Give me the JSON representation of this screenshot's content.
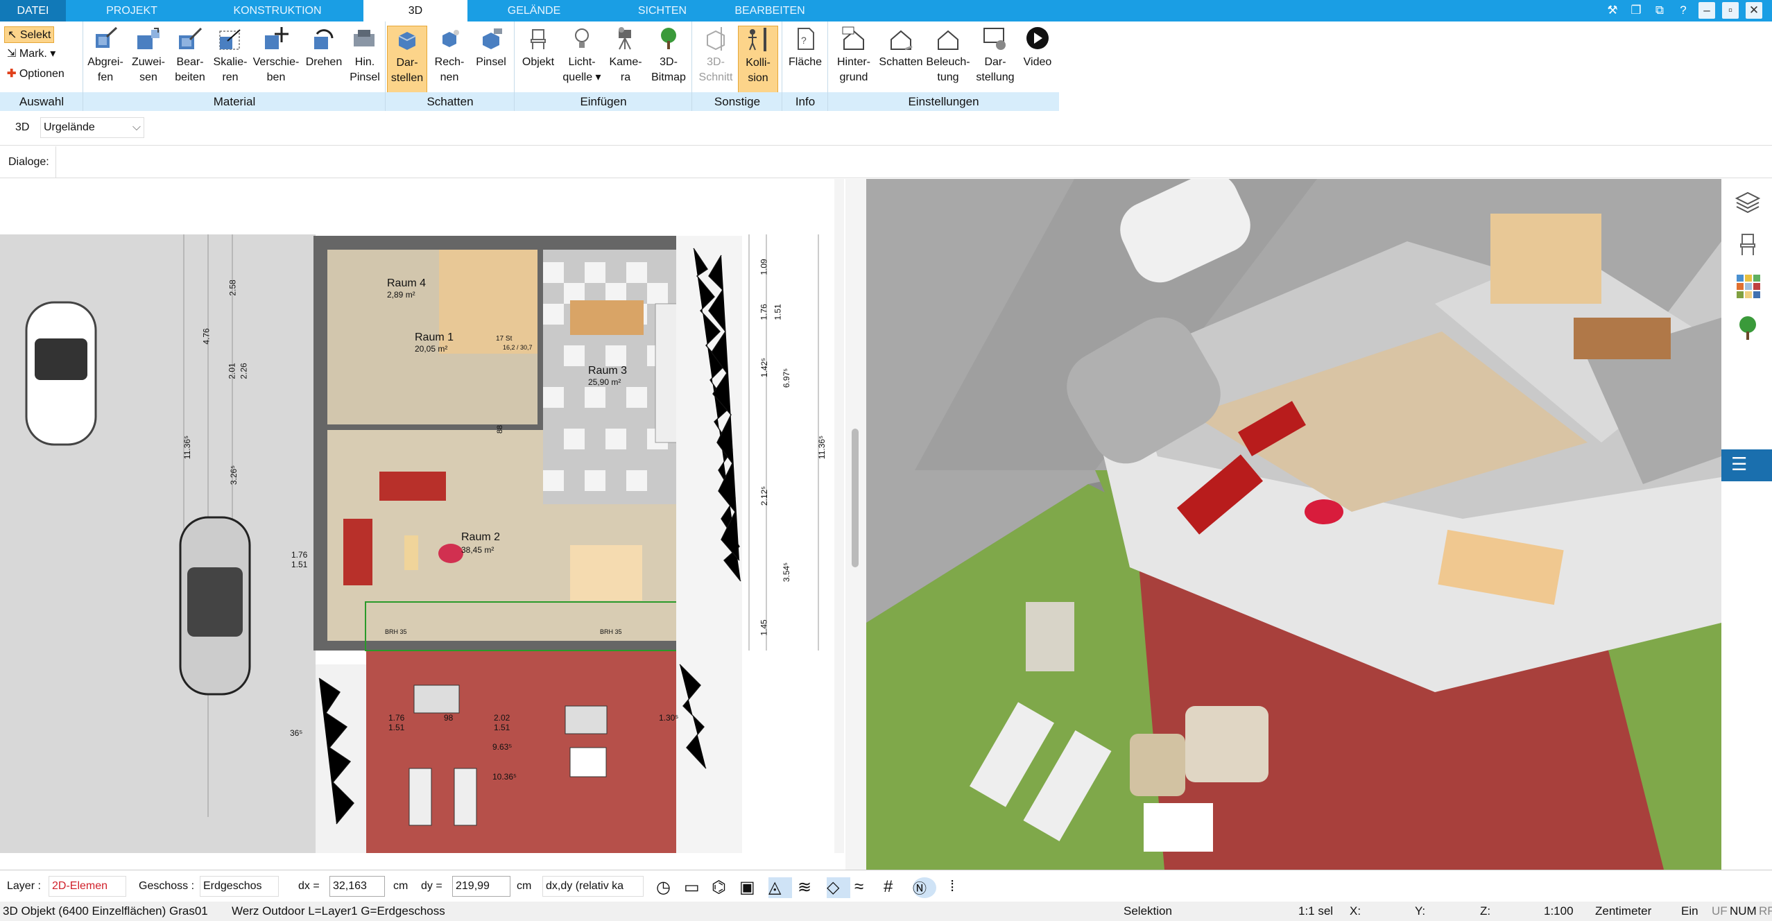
{
  "menu": {
    "tabs": [
      "DATEI",
      "PROJEKT",
      "KONSTRUKTION",
      "3D",
      "GELÄNDE",
      "SICHTEN",
      "BEARBEITEN"
    ]
  },
  "ribbon": {
    "auswahl": {
      "label": "Auswahl",
      "items": [
        "Selekt",
        "Mark.",
        "Optionen"
      ]
    },
    "material": {
      "label": "Material",
      "buttons": [
        [
          "Abgrei-",
          "fen"
        ],
        [
          "Zuwei-",
          "sen"
        ],
        [
          "Bear-",
          "beiten"
        ],
        [
          "Skalie-",
          "ren"
        ],
        [
          "Verschie-",
          "ben"
        ],
        [
          "Drehen",
          ""
        ],
        [
          "Hin.",
          "Pinsel"
        ]
      ]
    },
    "schatten": {
      "label": "Schatten",
      "buttons": [
        [
          "Dar-",
          "stellen"
        ],
        [
          "Rech-",
          "nen"
        ],
        [
          "Pinsel",
          ""
        ]
      ]
    },
    "einfuegen": {
      "label": "Einfügen",
      "buttons": [
        [
          "Objekt",
          ""
        ],
        [
          "Licht-",
          "quelle ▾"
        ],
        [
          "Kame-",
          "ra"
        ],
        [
          "3D-",
          "Bitmap"
        ]
      ]
    },
    "sonstige": {
      "label": "Sonstige",
      "buttons": [
        [
          "3D-",
          "Schnitt"
        ],
        [
          "Kolli-",
          "sion"
        ]
      ]
    },
    "info": {
      "label": "Info",
      "buttons": [
        [
          "Fläche",
          ""
        ]
      ]
    },
    "einstellungen": {
      "label": "Einstellungen",
      "buttons": [
        [
          "Hinter-",
          "grund"
        ],
        [
          "Schatten",
          ""
        ],
        [
          "Beleuch-",
          "tung"
        ],
        [
          "Dar-",
          "stellung"
        ],
        [
          "Video",
          ""
        ]
      ]
    }
  },
  "selector": {
    "mode": "3D",
    "value": "Urgelände"
  },
  "dialoge": {
    "label": "Dialoge:"
  },
  "plan": {
    "rooms": [
      {
        "name": "Raum 4",
        "area": "2,89 m²"
      },
      {
        "name": "Raum 1",
        "area": "20,05 m²"
      },
      {
        "name": "Raum 3",
        "area": "25,90 m²"
      },
      {
        "name": "Raum 2",
        "area": "38,45 m²"
      }
    ],
    "dims": [
      "1.76",
      "1.51",
      "2.01",
      "2.26",
      "4.76",
      "2.58",
      "11.36⁵",
      "3.26⁵",
      "1.09",
      "1.76",
      "1.51",
      "1.42⁵",
      "6.97⁵",
      "11.36⁵",
      "2.12⁵",
      "3.54⁵",
      "1.45",
      "9.63⁵",
      "10.36⁵",
      "2.02",
      "1.51",
      "1.30⁵",
      "88",
      "17 St",
      "16,2 / 30,7",
      "BRH 35",
      "36⁵",
      "1.76",
      "1.51",
      "98"
    ]
  },
  "layer": {
    "label": "Layer :",
    "value": "2D-Elemen",
    "geschoss_label": "Geschoss :",
    "geschoss": "Erdgeschos",
    "dx_label": "dx =",
    "dx": "32,163",
    "dx_unit": "cm",
    "dy_label": "dy =",
    "dy": "219,99",
    "dy_unit": "cm",
    "mode": "dx,dy (relativ ka"
  },
  "status": {
    "left": "3D Objekt (6400 Einzelflächen) Gras01",
    "middle": "Werz Outdoor L=Layer1 G=Erdgeschoss",
    "sel": "Selektion",
    "count": "1:1 sel",
    "x": "X:",
    "y": "Y:",
    "z": "Z:",
    "scale": "1:100",
    "unit": "Zentimeter",
    "ein": "Ein",
    "uf": "UF",
    "num": "NUM",
    "rf": "RF"
  },
  "colors": {
    "accent": "#1a9ee4",
    "terrace": "#b6504a",
    "floor": "#d8ccb3"
  }
}
